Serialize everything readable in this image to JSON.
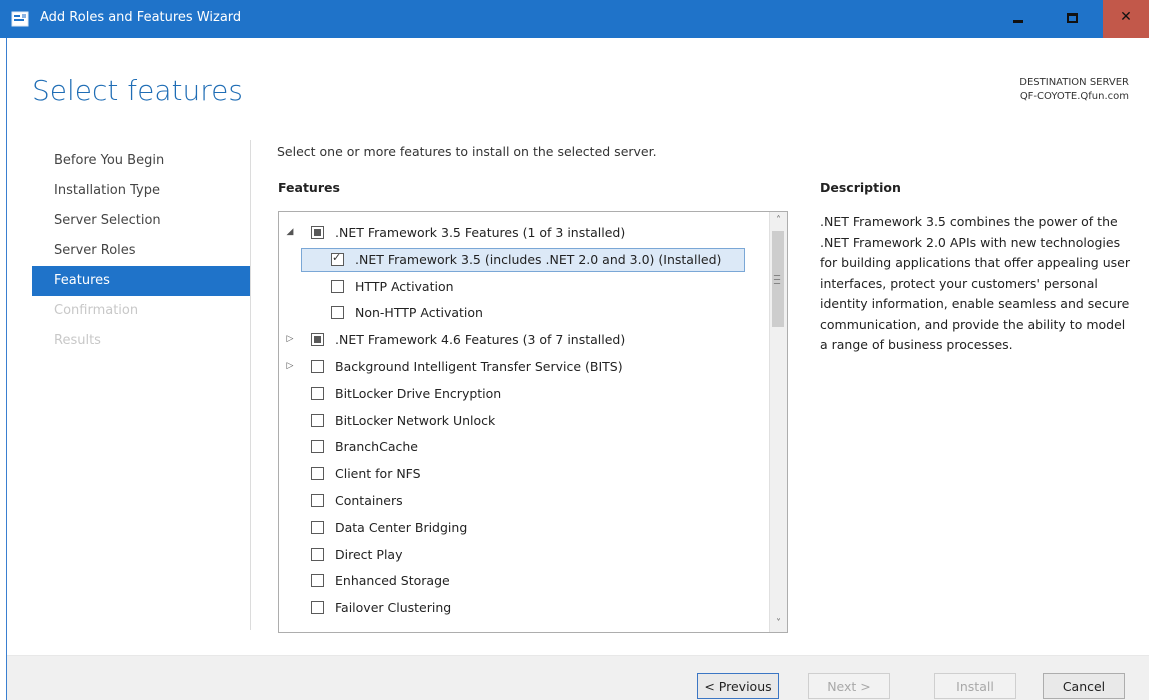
{
  "window": {
    "title": "Add Roles and Features Wizard",
    "accent": "#1f73c9",
    "close_color": "#c2584a"
  },
  "page": {
    "title": "Select features",
    "destination_label": "DESTINATION SERVER",
    "destination_server": "QF-COYOTE.Qfun.com",
    "instruction": "Select one or more features to install on the selected server."
  },
  "nav": {
    "items": [
      {
        "label": "Before You Begin",
        "state": "normal"
      },
      {
        "label": "Installation Type",
        "state": "normal"
      },
      {
        "label": "Server Selection",
        "state": "normal"
      },
      {
        "label": "Server Roles",
        "state": "normal"
      },
      {
        "label": "Features",
        "state": "active"
      },
      {
        "label": "Confirmation",
        "state": "disabled"
      },
      {
        "label": "Results",
        "state": "disabled"
      }
    ]
  },
  "features": {
    "header": "Features",
    "items": [
      {
        "label": ".NET Framework 3.5 Features (1 of 3 installed)",
        "level": 0,
        "expander": "expanded",
        "check": "indeterminate",
        "selected": false
      },
      {
        "label": ".NET Framework 3.5 (includes .NET 2.0 and 3.0) (Installed)",
        "level": 1,
        "expander": "none",
        "check": "checked",
        "selected": true
      },
      {
        "label": "HTTP Activation",
        "level": 1,
        "expander": "none",
        "check": "unchecked",
        "selected": false
      },
      {
        "label": "Non-HTTP Activation",
        "level": 1,
        "expander": "none",
        "check": "unchecked",
        "selected": false
      },
      {
        "label": ".NET Framework 4.6 Features (3 of 7 installed)",
        "level": 0,
        "expander": "collapsed",
        "check": "indeterminate",
        "selected": false
      },
      {
        "label": "Background Intelligent Transfer Service (BITS)",
        "level": 0,
        "expander": "collapsed",
        "check": "unchecked",
        "selected": false
      },
      {
        "label": "BitLocker Drive Encryption",
        "level": 0,
        "expander": "none",
        "check": "unchecked",
        "selected": false
      },
      {
        "label": "BitLocker Network Unlock",
        "level": 0,
        "expander": "none",
        "check": "unchecked",
        "selected": false
      },
      {
        "label": "BranchCache",
        "level": 0,
        "expander": "none",
        "check": "unchecked",
        "selected": false
      },
      {
        "label": "Client for NFS",
        "level": 0,
        "expander": "none",
        "check": "unchecked",
        "selected": false
      },
      {
        "label": "Containers",
        "level": 0,
        "expander": "none",
        "check": "unchecked",
        "selected": false
      },
      {
        "label": "Data Center Bridging",
        "level": 0,
        "expander": "none",
        "check": "unchecked",
        "selected": false
      },
      {
        "label": "Direct Play",
        "level": 0,
        "expander": "none",
        "check": "unchecked",
        "selected": false
      },
      {
        "label": "Enhanced Storage",
        "level": 0,
        "expander": "none",
        "check": "unchecked",
        "selected": false
      },
      {
        "label": "Failover Clustering",
        "level": 0,
        "expander": "none",
        "check": "unchecked",
        "selected": false
      }
    ]
  },
  "description": {
    "header": "Description",
    "text": ".NET Framework 3.5 combines the power of the .NET Framework 2.0 APIs with new technologies for building applications that offer appealing user interfaces, protect your customers' personal identity information, enable seamless and secure communication, and provide the ability to model a range of business processes."
  },
  "buttons": {
    "previous": "< Previous",
    "next": "Next >",
    "install": "Install",
    "cancel": "Cancel"
  }
}
